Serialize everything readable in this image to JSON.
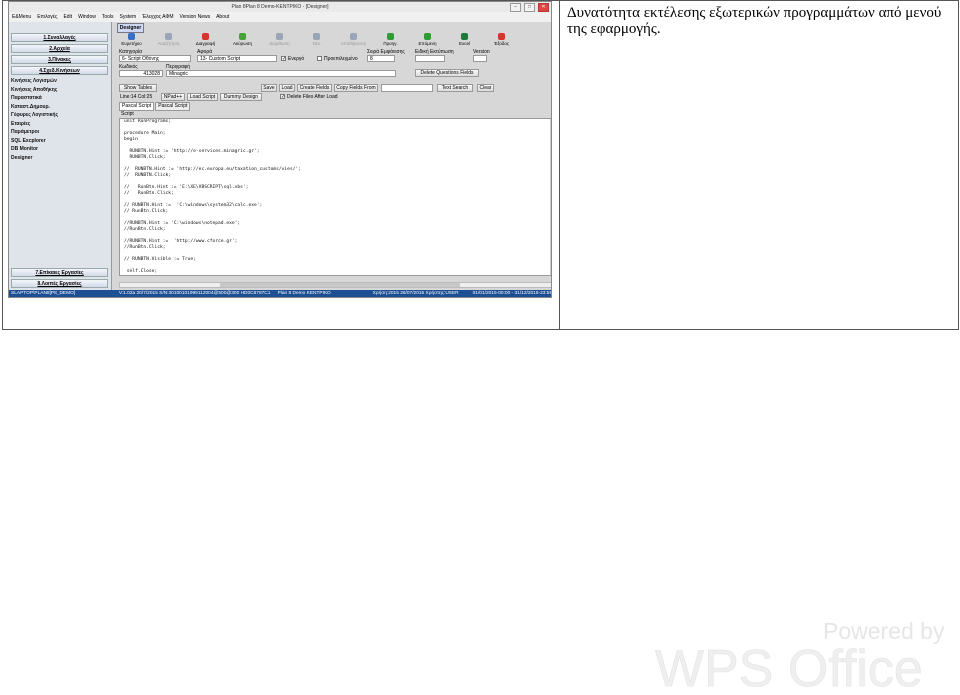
{
  "caption": "Δυνατότητα εκτέλεσης εξωτερικών προγραμμάτων από μενού της εφαρμογής.",
  "window": {
    "title": "Plan 8Plan 8 Demo-ΚΕΝΤΡΙΚΟ - [Designer]",
    "controls": [
      "–",
      "□",
      "✕"
    ]
  },
  "menu": [
    "Ε&Menu",
    "Επιλογές",
    "Edit",
    "Window",
    "Tools",
    "System",
    "Έλεγχος ΑΦΜ",
    "Version News",
    "About"
  ],
  "sidebar": {
    "top_buttons": [
      "1.Συναλλαγές",
      "2.Αρχεία",
      "3.Πίνακες",
      "4.Σχεδ.Κινήσεων"
    ],
    "items": [
      "Κινήσεις Λογισμών",
      "Κινήσεις Αποθήκης",
      "Παραστατικά",
      "Καταστ.Δημουρ.",
      "Γέφυρες Λογιστικής",
      "Εταιρίες",
      "Παράμετροι",
      "SQL Excplorer",
      "DB Monitor",
      "Designer"
    ],
    "bottom_buttons": [
      "7.Επίκαιες Εργασίες",
      "8.Λοιπές Εργασίες"
    ]
  },
  "designer_tab": "Designer",
  "toolbar": [
    {
      "label": "Ευρετήριο",
      "icon": "index-icon",
      "color": "#3b6fc4",
      "enabled": true
    },
    {
      "label": "Αναζήτηση",
      "icon": "search-icon",
      "color": "#9aa6b8",
      "enabled": false
    },
    {
      "label": "Διαγραφή",
      "icon": "delete-icon",
      "color": "#d9342b",
      "enabled": true
    },
    {
      "label": "Ακύρωση",
      "icon": "undo-icon",
      "color": "#49a13b",
      "enabled": true
    },
    {
      "label": "Διόρθωση",
      "icon": "edit-icon",
      "color": "#9aa6b8",
      "enabled": false
    },
    {
      "label": "Νέο",
      "icon": "new-icon",
      "color": "#9aa6b8",
      "enabled": false
    },
    {
      "label": "Αποθήκευση",
      "icon": "save-icon",
      "color": "#9aa6b8",
      "enabled": false
    },
    {
      "label": "Προηγ.",
      "icon": "prev-icon",
      "color": "#2e9b35",
      "enabled": true
    },
    {
      "label": "Επόμενη",
      "icon": "next-icon",
      "color": "#2e9b35",
      "enabled": true
    },
    {
      "label": "Excel",
      "icon": "excel-icon",
      "color": "#1f7a3a",
      "enabled": true
    },
    {
      "label": "Έξοδος",
      "icon": "exit-icon",
      "color": "#d9342b",
      "enabled": true
    }
  ],
  "form": {
    "category_label": "Κατηγορία",
    "category_value": "6- Script Οθόνης",
    "subject_label": "Αφορά",
    "subject_value": "13- Custom Script",
    "active_label": "Ενεργό",
    "predefined_label": "Προεπιλεγμένο",
    "order_label": "Σειρά Εμφάνισης",
    "order_value": "8",
    "special_print_label": "Ειδική Εκτύπωση",
    "version_label": "Version",
    "code_label": "Κωδικός",
    "code_value": "413028",
    "description_label": "Περιγραφή",
    "description_value": "Minagric",
    "delete_fields_button": "Delete Questions Fields"
  },
  "actions": {
    "show_tables": "Show Tables",
    "save": "Save",
    "load": "Load",
    "create_fields": "Create Fields",
    "copy_fields_from": "Copy Fields From",
    "text_search": "Text Search",
    "clear": "Clear",
    "line_col": "Line:14  Col:25",
    "npad": "NPad++",
    "load_script": "Load Script",
    "dummy_design": "Dummy Design",
    "delete_files": "Delete Files After Load"
  },
  "script_tabs": [
    "Pascal Script",
    "Pascal Script"
  ],
  "script_label": "Script",
  "code": [
    "unit RunPrograms;",
    "",
    "procedure Main;",
    "begin",
    "",
    "  RUNBTN.Hint := 'http://e-services.minagric.gr';",
    "  RUNBTN.Click;",
    "",
    "//  RUNBTN.Hint := 'http://ec.europa.eu/taxation_customs/vies/';",
    "//  RUNBTN.Click;",
    "",
    "//   RunBtn.Hint := 'E:\\XE\\VBSCRIPT\\sql.vbs';",
    "//   RunBtn.Click;",
    "",
    "// RUNBTN.Hint :=  'C:\\windows\\system32\\calc.exe';",
    "// RunBtn.Click;",
    "",
    "//RUNBTN.Hint := 'C:\\windows\\notepad.exe';",
    "//RunBtn.Click;",
    "",
    "//RUNBTN.Hint :=  'http://www.cforce.gr';",
    "//RunBtn.Click;",
    "",
    "// RUNBTN.Visible := True;",
    "",
    " self.Close;"
  ],
  "status": [
    "SLAPTOP\\PLAN8[P8_DEMO]",
    "V:1.02a 20/7/2015 S/N:30100101999112004@500@300 HD0C6787C1",
    "Plan 8 Demo ΚΕΝΤΡΙΚΟ",
    "Χρήση:2015 26/07/2015  Χρήστης:USER",
    "01/01/2015-00:00 - 31/12/2015-23:59"
  ],
  "watermark": {
    "powered": "Powered by",
    "brand": "WPS Office"
  }
}
